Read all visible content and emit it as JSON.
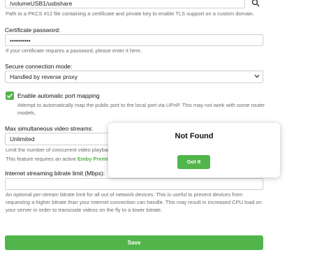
{
  "cert_path": {
    "value": "/volumeUSB1/usbshare",
    "help": "Path to a PKCS #12 file containing a certificate and private key to enable TLS support on a custom domain."
  },
  "cert_password": {
    "label": "Certificate password:",
    "value": "••••••••••",
    "help": "If your certificate requires a password, please enter it here."
  },
  "secure_mode": {
    "label": "Secure connection mode:",
    "value": "Handled by reverse proxy"
  },
  "port_mapping": {
    "label": "Enable automatic port mapping",
    "checked": true,
    "help": "Attempt to automatically map the public port to the local port via UPnP. This may not work with some router models."
  },
  "video_streams": {
    "label": "Max simultaneous video streams:",
    "value": "Unlimited",
    "help": "Limit the number of concurrent video playbac",
    "feature_text": "This feature requires an active ",
    "feature_link": "Emby Premier"
  },
  "bitrate": {
    "label": "Internet streaming bitrate limit (Mbps):",
    "value": "",
    "help": "An optional per-stream bitrate limit for all out of network devices. This is useful to prevent devices from requesting a higher bitrate than your internet connection can handle. This may result in increased CPU load on your server in order to transcode videos on the fly to a lower bitrate."
  },
  "save_label": "Save",
  "dialog": {
    "title": "Not Found",
    "button_label": "Got It"
  },
  "colors": {
    "accent": "#52b54b"
  }
}
